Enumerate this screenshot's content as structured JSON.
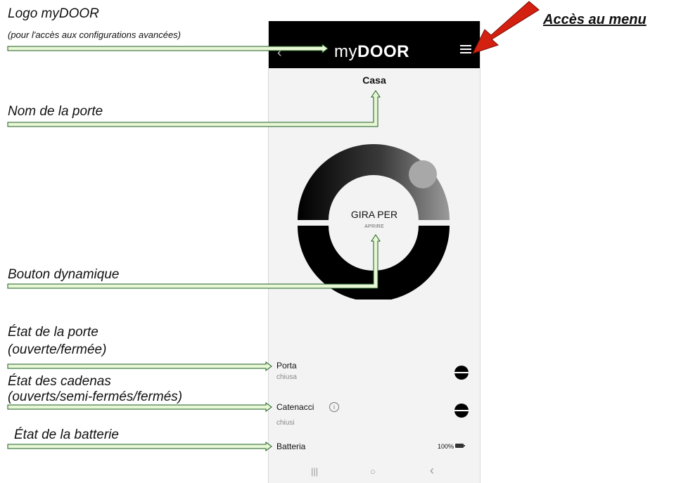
{
  "annotations": {
    "logo_title": "Logo myDOOR",
    "logo_sub": "(pour l'accès aux configurations avancées)",
    "menu_access": "Accès au menu",
    "door_name": "Nom de la porte",
    "dynamic_button": "Bouton dynamique",
    "door_state_1": "État de la porte",
    "door_state_2": "(ouverte/fermée)",
    "locks_state_1": "État des cadenas",
    "locks_state_2": "(ouverts/semi-fermés/fermés)",
    "battery_state": "État de la batterie"
  },
  "app": {
    "logo_my": "my",
    "logo_door": "DOOR",
    "back_icon": "‹",
    "door_name": "Casa",
    "dial": {
      "label": "GIRA PER",
      "sub": "APRIRE",
      "progress": 0.3
    },
    "status": [
      {
        "label": "Porta",
        "value": "chiusa"
      },
      {
        "label": "Catenacci",
        "value": "chiusi",
        "info_icon": "i"
      }
    ],
    "battery": {
      "label": "Batteria",
      "value": "100%"
    }
  },
  "navbar": {
    "recent": "|||",
    "home": "○",
    "back": "‹"
  },
  "colors": {
    "arrow_fill": "#e8f7d6",
    "arrow_stroke": "#1b5e20",
    "red_arrow": "#d32011"
  }
}
